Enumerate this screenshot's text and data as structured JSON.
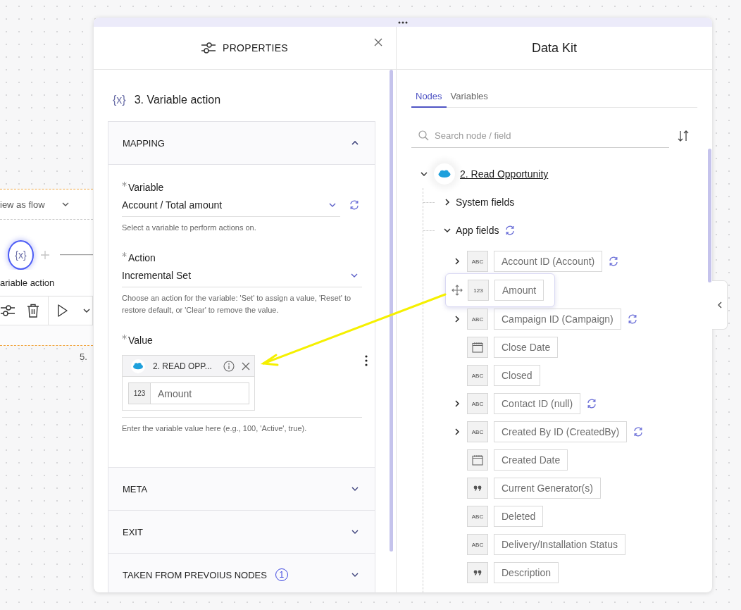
{
  "canvas": {
    "view_menu": "iew as flow",
    "node": {
      "icon": "{x}",
      "label": "ariable action",
      "selected": true
    },
    "step_number": "5."
  },
  "properties": {
    "title": "PROPERTIES",
    "step": {
      "icon": "{x}",
      "title": "3. Variable action"
    },
    "sections": [
      {
        "title": "MAPPING",
        "expanded": true,
        "fields": [
          {
            "kind": "select",
            "label": "Variable",
            "required": true,
            "value": "Account / Total amount",
            "sync": true,
            "hint": "Select a variable to perform actions on."
          },
          {
            "kind": "select",
            "label": "Action",
            "required": true,
            "value": "Incremental Set",
            "sync": false,
            "hint": "Choose an action for the variable: 'Set' to assign a value, 'Reset' to restore default, or 'Clear' to remove the value."
          },
          {
            "kind": "mapped",
            "label": "Value",
            "required": true,
            "source": "2. READ OPP...",
            "type_label": "123",
            "field": "Amount",
            "hint": "Enter the variable value here (e.g., 100, 'Active', true)."
          }
        ]
      },
      {
        "title": "META",
        "expanded": false
      },
      {
        "title": "EXIT",
        "expanded": false
      },
      {
        "title": "TAKEN FROM PREVOIUS NODES",
        "expanded": false,
        "badge": "1"
      }
    ]
  },
  "data_kit": {
    "title": "Data Kit",
    "tabs": [
      {
        "label": "Nodes",
        "selected": true
      },
      {
        "label": "Variables",
        "selected": false
      }
    ],
    "search": {
      "placeholder": "Search node / field"
    },
    "tree": [
      {
        "label": "2. Read Opportunity",
        "expanded": true,
        "children": [
          {
            "label": "System fields",
            "expanded": false,
            "sync": false
          },
          {
            "label": "App fields",
            "expanded": true,
            "sync": true,
            "children": [
              {
                "name": "Account ID (Account)",
                "kind": "text",
                "type_label": "ABC",
                "expandable": true,
                "sync": true,
                "dragging": false
              },
              {
                "name": "Amount",
                "kind": "number",
                "type_label": "123",
                "expandable": false,
                "sync": false,
                "dragging": true
              },
              {
                "name": "Campaign ID (Campaign)",
                "kind": "text",
                "type_label": "ABC",
                "expandable": true,
                "sync": true,
                "dragging": false
              },
              {
                "name": "Close Date",
                "kind": "date",
                "expandable": false,
                "sync": false,
                "dragging": false
              },
              {
                "name": "Closed",
                "kind": "text",
                "type_label": "ABC",
                "expandable": false,
                "sync": false,
                "dragging": false
              },
              {
                "name": "Contact ID (null)",
                "kind": "text",
                "type_label": "ABC",
                "expandable": true,
                "sync": true,
                "dragging": false
              },
              {
                "name": "Created By ID (CreatedBy)",
                "kind": "text",
                "type_label": "ABC",
                "expandable": true,
                "sync": true,
                "dragging": false
              },
              {
                "name": "Created Date",
                "kind": "date",
                "expandable": false,
                "sync": false,
                "dragging": false
              },
              {
                "name": "Current Generator(s)",
                "kind": "long_text",
                "expandable": false,
                "sync": false,
                "dragging": false
              },
              {
                "name": "Deleted",
                "kind": "text",
                "type_label": "ABC",
                "expandable": false,
                "sync": false,
                "dragging": false
              },
              {
                "name": "Delivery/Installation Status",
                "kind": "text",
                "type_label": "ABC",
                "expandable": false,
                "sync": false,
                "dragging": false
              },
              {
                "name": "Description",
                "kind": "long_text",
                "expandable": false,
                "sync": false,
                "dragging": false
              }
            ]
          }
        ]
      }
    ]
  }
}
